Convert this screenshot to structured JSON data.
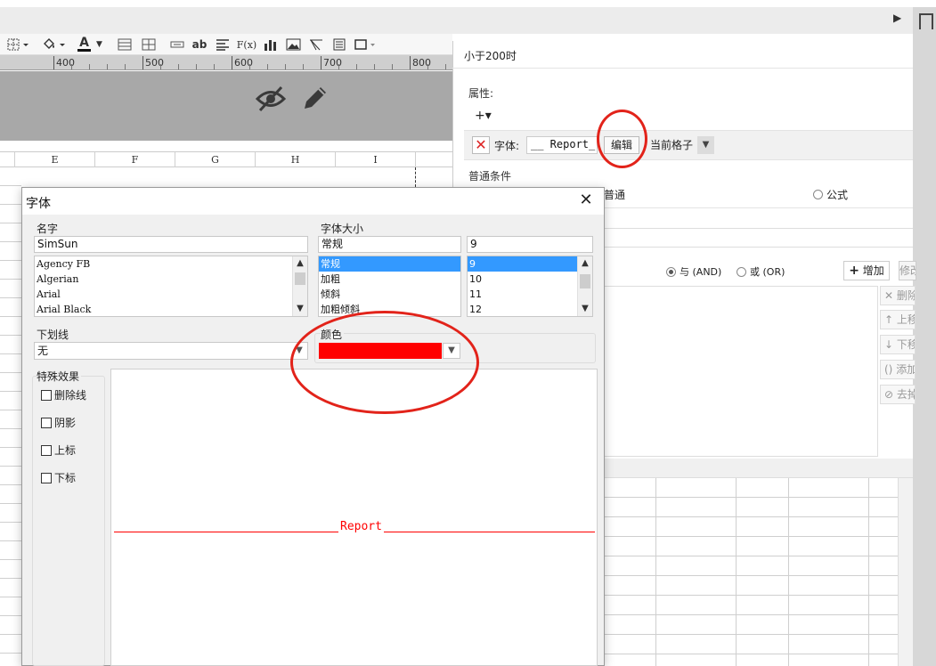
{
  "window": {
    "right_panel_title": "小于200时"
  },
  "toolbar": {
    "icons": [
      "border-icon",
      "fill-color-icon",
      "font-color-icon",
      "table-icon",
      "grid-icon",
      "field-icon",
      "text-icon",
      "align-icon",
      "formula-icon",
      "chart-icon",
      "image-icon",
      "slash-icon",
      "list-icon",
      "frame-icon"
    ],
    "ab_label": "ab",
    "fx_label": "F(x)",
    "font_color_letter": "A"
  },
  "ruler": {
    "labels": [
      "400",
      "500",
      "600",
      "700",
      "800"
    ]
  },
  "canvas": {
    "icons": [
      "hide-eye-icon",
      "edit-pencil-icon"
    ]
  },
  "sheet": {
    "columns": [
      "E",
      "F",
      "G",
      "H",
      "I"
    ]
  },
  "rules_panel": {
    "attributes_label": "属性:",
    "add_label": "+▾",
    "font_label": "字体:",
    "font_preview": "__ Report_",
    "edit_button": "编辑",
    "scope_value": "当前格子",
    "conditions_label": "普通条件",
    "normal_label": "普通",
    "formula_label": "公式",
    "and_label": "与 (AND)",
    "or_label": "或 (OR)",
    "add_button": "增加",
    "modify_button": "修改",
    "side_buttons": [
      "删除",
      "上移",
      "下移",
      "添加括号",
      "去掉括号"
    ]
  },
  "font_dialog": {
    "title": "字体",
    "name_label": "名字",
    "name_value": "SimSun",
    "font_list": [
      "Agency FB",
      "Algerian",
      "Arial",
      "Arial Black"
    ],
    "style_label": "字体大小",
    "style_value": "常规",
    "style_list": [
      "常规",
      "加粗",
      "倾斜",
      "加粗倾斜"
    ],
    "style_selected": 0,
    "size_value": "9",
    "size_list": [
      "9",
      "10",
      "11",
      "12"
    ],
    "size_selected": 0,
    "underline_label": "下划线",
    "underline_value": "无",
    "color_label": "颜色",
    "color_value": "#ff0000",
    "effects_label": "特殊效果",
    "effects": [
      "删除线",
      "阴影",
      "上标",
      "下标"
    ],
    "preview_text": "Report"
  },
  "annotations": {
    "color": "#e2231a"
  }
}
